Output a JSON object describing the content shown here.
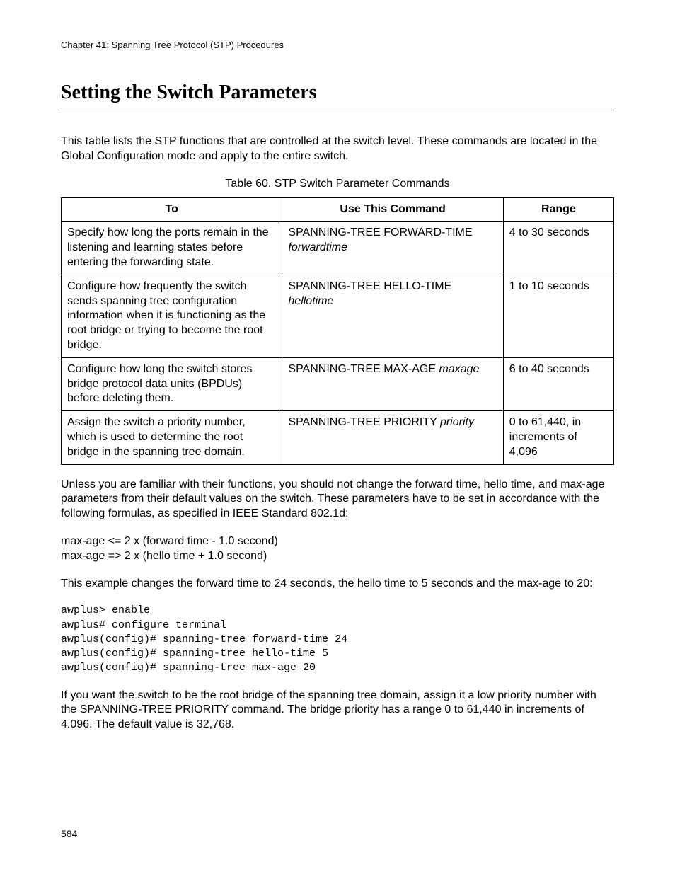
{
  "header": {
    "chapter_line": "Chapter 41: Spanning Tree Protocol (STP) Procedures"
  },
  "title": "Setting the Switch Parameters",
  "intro_paragraph": "This table lists the STP functions that are controlled at the switch level. These commands are located in the Global Configuration mode and apply to the entire switch.",
  "table": {
    "caption": "Table 60. STP Switch Parameter Commands",
    "headers": {
      "to": "To",
      "command": "Use This Command",
      "range": "Range"
    },
    "rows": [
      {
        "to": "Specify how long the ports remain in the listening and learning states before entering the forwarding state.",
        "cmd_name": "SPANNING-TREE FORWARD-TIME",
        "cmd_param": "forwardtime",
        "cmd_joiner": "newline",
        "range": "4 to 30 seconds"
      },
      {
        "to": "Configure how frequently the switch sends spanning tree configuration information when it is functioning as the root bridge or trying to become the root bridge.",
        "cmd_name": "SPANNING-TREE HELLO-TIME",
        "cmd_param": "hellotime",
        "cmd_joiner": "newline",
        "range": "1 to 10 seconds"
      },
      {
        "to": "Configure how long the switch stores bridge protocol data units (BPDUs) before deleting them.",
        "cmd_name": "SPANNING-TREE MAX-AGE",
        "cmd_param": "maxage",
        "cmd_joiner": "space",
        "range": "6 to 40 seconds"
      },
      {
        "to": "Assign the switch a priority number, which is used to determine the root bridge in the spanning tree domain.",
        "cmd_name": "SPANNING-TREE PRIORITY",
        "cmd_param": "priority",
        "cmd_joiner": "space",
        "range": "0 to 61,440, in increments of 4,096"
      }
    ]
  },
  "after_table_paragraph": "Unless you are familiar with their functions, you should not change the forward time, hello time, and max-age parameters from their default values on the switch. These parameters have to be set in accordance with the following formulas, as specified in IEEE Standard 802.1d:",
  "formulas": {
    "line1": "max-age <= 2 x (forward time - 1.0 second)",
    "line2": "max-age => 2 x (hello time + 1.0 second)"
  },
  "example_intro": "This example changes the forward time to 24 seconds, the hello time to 5 seconds and the max-age to 20:",
  "code": {
    "l1": "awplus> enable",
    "l2": "awplus# configure terminal",
    "l3": "awplus(config)# spanning-tree forward-time 24",
    "l4": "awplus(config)# spanning-tree hello-time 5",
    "l5": "awplus(config)# spanning-tree max-age 20"
  },
  "closing_paragraph": "If you want the switch to be the root bridge of the spanning tree domain, assign it a low priority number with the SPANNING-TREE PRIORITY command. The bridge priority has a range 0 to 61,440 in increments of 4.096. The default value is 32,768.",
  "page_number": "584"
}
